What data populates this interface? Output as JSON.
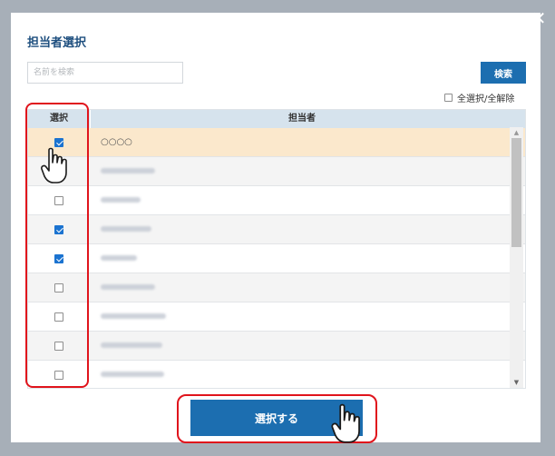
{
  "dialog": {
    "title": "担当者選択",
    "close_glyph": "✕"
  },
  "search": {
    "placeholder": "名前を検索",
    "value": "",
    "button_label": "検索"
  },
  "select_all": {
    "label": "全選択/全解除",
    "checked": false
  },
  "table": {
    "headers": {
      "select": "選択",
      "person": "担当者"
    },
    "rows": [
      {
        "checked": true,
        "name": "○○○○"
      },
      {
        "checked": false,
        "name": ""
      },
      {
        "checked": false,
        "name": ""
      },
      {
        "checked": true,
        "name": ""
      },
      {
        "checked": true,
        "name": ""
      },
      {
        "checked": false,
        "name": ""
      },
      {
        "checked": false,
        "name": ""
      },
      {
        "checked": false,
        "name": ""
      },
      {
        "checked": false,
        "name": ""
      }
    ]
  },
  "submit": {
    "label": "選択する"
  },
  "colors": {
    "brand_blue": "#1c6eb0",
    "title_blue": "#1d4e7e",
    "highlight_row": "#fbe8cc",
    "annotation_red": "#e0141c",
    "overlay": "#a7afb8"
  },
  "icons": {
    "close": "close-icon",
    "pointer": "hand-pointer-icon",
    "scroll_up": "arrow-up-icon",
    "scroll_down": "arrow-down-icon"
  }
}
